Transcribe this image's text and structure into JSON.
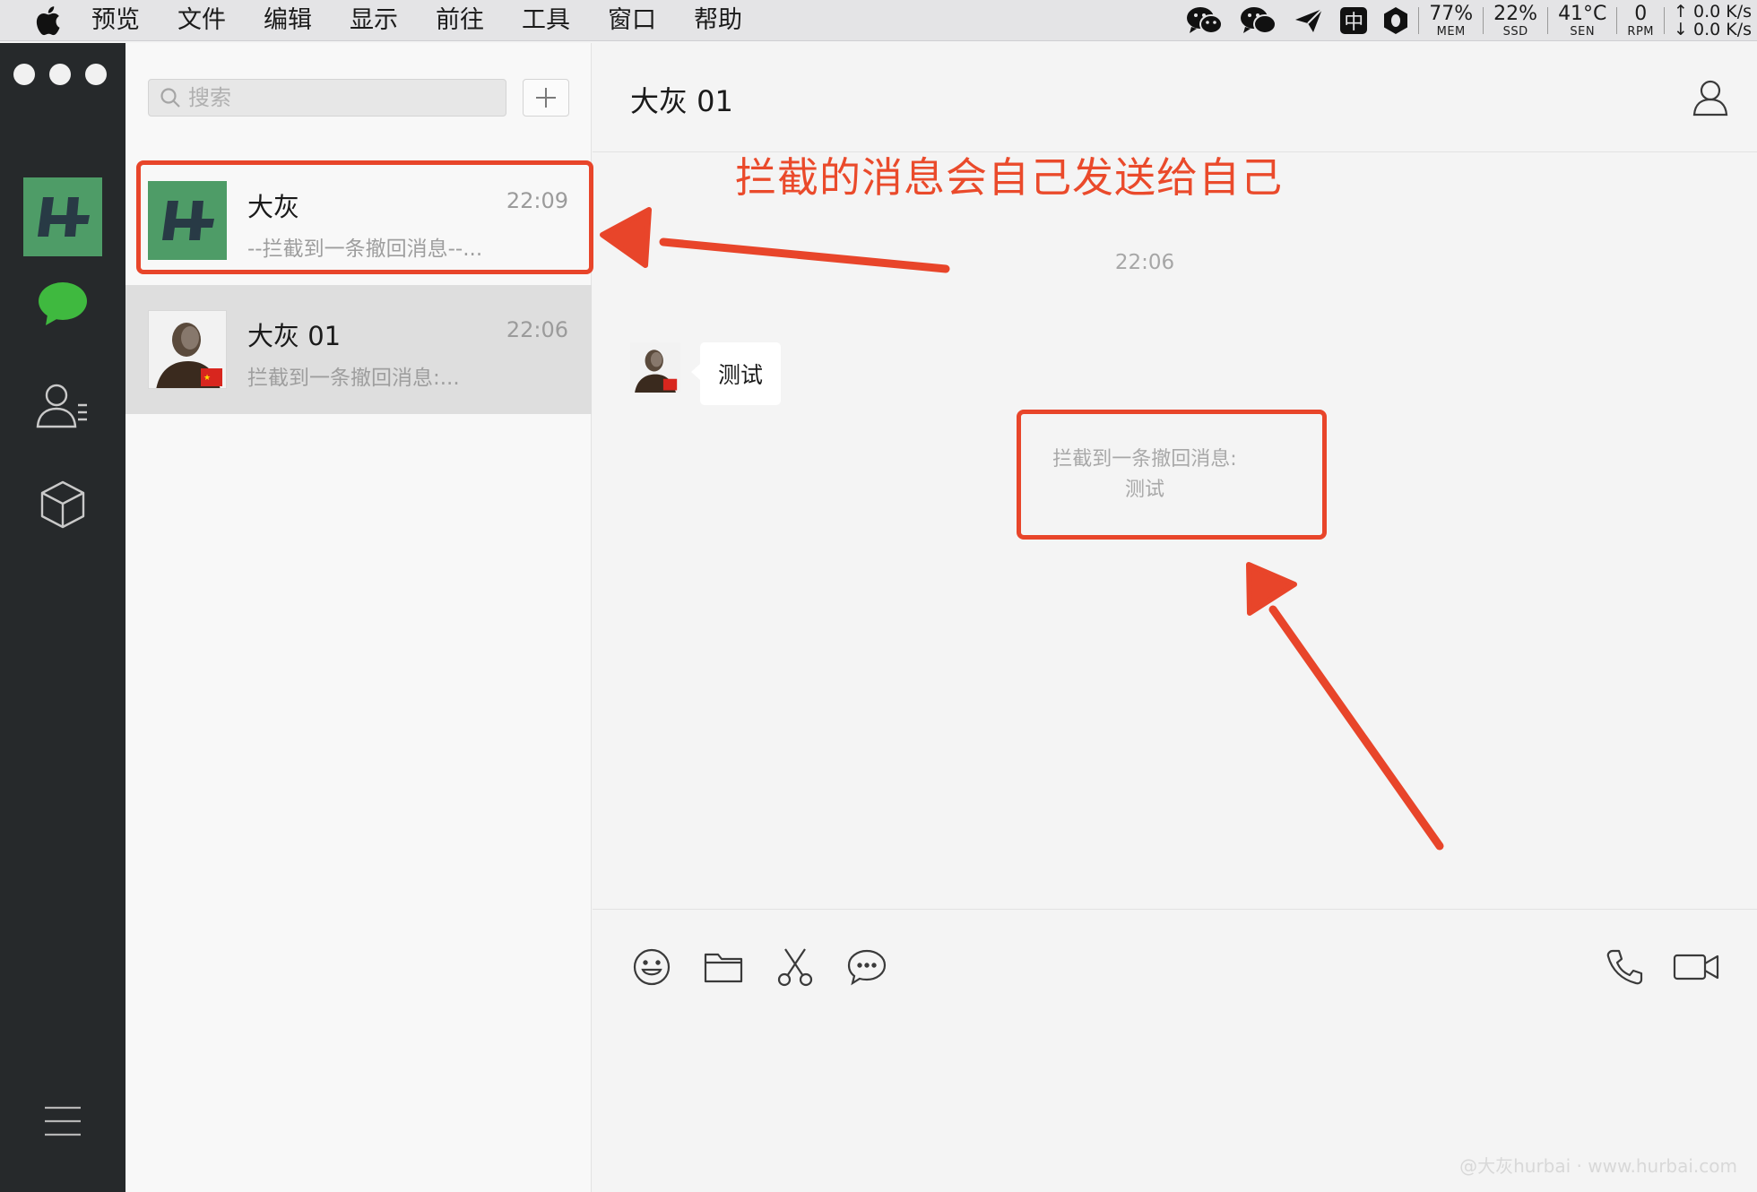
{
  "menubar": {
    "app_menus": [
      "预览",
      "文件",
      "编辑",
      "显示",
      "前往",
      "工具",
      "窗口",
      "帮助"
    ],
    "stats": [
      {
        "value": "77%",
        "label": "MEM"
      },
      {
        "value": "22%",
        "label": "SSD"
      },
      {
        "value": "41°C",
        "label": "SEN"
      },
      {
        "value": "0",
        "label": "RPM"
      }
    ],
    "net_up": "0.0 K/s",
    "net_down": "0.0 K/s",
    "input_method": "中"
  },
  "sidebar": {
    "search_placeholder": "搜索",
    "chats": [
      {
        "name": "大灰",
        "time": "22:09",
        "preview": "--拦截到一条撤回消息--..."
      },
      {
        "name": "大灰 01",
        "time": "22:06",
        "preview": "拦截到一条撤回消息:..."
      }
    ]
  },
  "conversation": {
    "title": "大灰 01",
    "time_separator": "22:06",
    "message_text": "测试",
    "system_message_line1": "拦截到一条撤回消息:",
    "system_message_line2": "测试"
  },
  "annotation": {
    "text": "拦截的消息会自己发送给自己",
    "color": "#e8452a"
  },
  "colors": {
    "nav_bg": "#26292b",
    "brand_green": "#4e9c67",
    "chat_icon_green": "#3fb93f"
  },
  "watermark": "@大灰hurbai · www.hurbai.com"
}
